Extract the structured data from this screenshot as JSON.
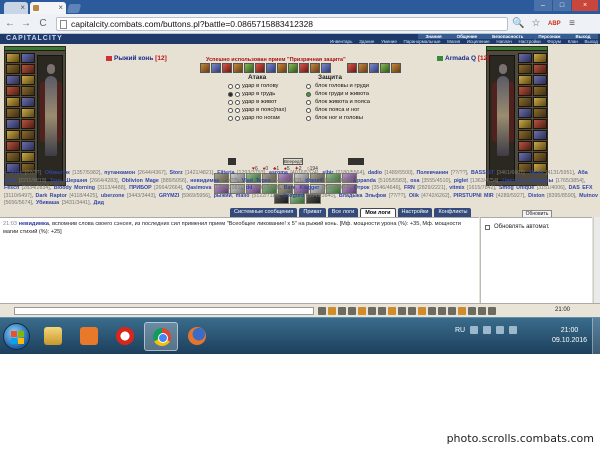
{
  "browser": {
    "tabs": [
      {
        "label": "",
        "close": "×"
      },
      {
        "label": "",
        "close": "×"
      }
    ],
    "window_controls": {
      "minimize": "–",
      "maximize": "□",
      "close": "×"
    },
    "nav": {
      "back": "←",
      "forward": "→",
      "reload": "C"
    },
    "url": "capitalcity.combats.com/buttons.pl?battle=0.0865715883412328",
    "tools": [
      "🔍",
      "☆",
      "ABP",
      "≡"
    ]
  },
  "site": {
    "logo": "CAPITALCITY",
    "top_menu": [
      "Инвентарь",
      "Здание",
      "Умение",
      "Паранормальные",
      "Магия",
      "Исцеление",
      "Наплач",
      "Настройки",
      "Форум",
      "Клан",
      "Выход"
    ],
    "sub_menu": [
      "Знания",
      "Общение",
      "Безопасность",
      "Персонаж",
      "Выход"
    ]
  },
  "battle": {
    "left_name": "Рыжий конь",
    "left_level": "[12]",
    "right_name": "Armada Q",
    "right_level": "[12]",
    "success_msg": "Успешно использован прием \"Призрачная защита\"",
    "attack_title": "Атака",
    "defense_title": "Защита",
    "attack_options": [
      "удар в голову",
      "удар в грудь",
      "удар в живот",
      "удар в пояс(пах)",
      "удар по ногам"
    ],
    "defense_options": [
      "блок головы и груди",
      "блок груди и живота",
      "блок живота и пояса",
      "блок пояса и ног",
      "блок ног и головы"
    ],
    "attack_button": "Вперед!!",
    "stats": [
      "6",
      "0",
      "1",
      "5",
      "2",
      "194"
    ]
  },
  "participants": [
    {
      "name": "s_fenix",
      "hp": "[??/??]"
    },
    {
      "name": "Обмылок",
      "hp": "[1357/5982]"
    },
    {
      "name": "путанкамон",
      "hp": "[2644/4367]"
    },
    {
      "name": "Storz",
      "hp": "[1421/4821]"
    },
    {
      "name": "Filteria",
      "hp": "[1293/3793]"
    },
    {
      "name": "asroma",
      "hp": "[4016/5324]"
    },
    {
      "name": "sibir",
      "hp": "[2180/5564]"
    },
    {
      "name": "dadio",
      "hp": "[1489/5500]"
    },
    {
      "name": "Полевчанин",
      "hp": "[??/??]"
    },
    {
      "name": "BASS-ST",
      "hp": "[3461/6667]"
    },
    {
      "name": "Yazav",
      "hp": "[4131/5951]"
    },
    {
      "name": "Аба хаба",
      "hp": "[2211/3819]"
    },
    {
      "name": "Тень Шершня",
      "hp": "[2664/4283]"
    },
    {
      "name": "Oblivion Mage",
      "hp": "[889/5056]"
    },
    {
      "name": "невидимка",
      "hp": "[??/??]"
    },
    {
      "name": "Vlad_Tepes",
      "hp": "[5618/5822]"
    },
    {
      "name": "titanelf",
      "hp": "[3133/4439]"
    },
    {
      "name": "ppanda",
      "hp": "[5105/5583]"
    },
    {
      "name": "osa",
      "hp": "[3555/4510]"
    },
    {
      "name": "piglet",
      "hp": "[1363/4754]"
    },
    {
      "name": "Цветочек Ланданы",
      "hp": "[1765/3854]"
    },
    {
      "name": "Fesch",
      "hp": "[2834/2834]"
    },
    {
      "name": "Bloody Morning",
      "hp": "[3113/4488]"
    },
    {
      "name": "ПРИБОР",
      "hp": "[2664/2664]"
    },
    {
      "name": "Qasimova",
      "hp": "[1469/3981]"
    },
    {
      "name": "dd",
      "hp": "[989/5473]"
    },
    {
      "name": "Bare",
      "hp": ""
    },
    {
      "name": "Klegger",
      "hp": "[2984/2984]"
    },
    {
      "name": "Отрок",
      "hp": "[3546/4646]"
    },
    {
      "name": "FRN",
      "hp": "[2829/2221]"
    },
    {
      "name": "vitmix",
      "hp": "[1615/7842]"
    },
    {
      "name": "Smog Unique",
      "hp": "[3151/4006]"
    },
    {
      "name": "DAS EFX",
      "hp": "[3110/6497]"
    },
    {
      "name": "Dark Raptor",
      "hp": "[4118/4425]"
    },
    {
      "name": "uberzone",
      "hp": "[3443/3443]"
    },
    {
      "name": "GRYMZI",
      "hp": "[5969/5956]"
    },
    {
      "name": "рыжий",
      "hp": ""
    },
    {
      "name": "malio",
      "hp": "[5122/7118]"
    },
    {
      "name": "bozgurd",
      "hp": "[3649/3840]"
    },
    {
      "name": "Владыка Эльфов",
      "hp": "[??/??]"
    },
    {
      "name": "Olik",
      "hp": "[4742/6262]"
    },
    {
      "name": "PIRSTUPNI MIR",
      "hp": "[4289/5927]"
    },
    {
      "name": "Diston",
      "hp": "[8395/8590]"
    },
    {
      "name": "Mutnov",
      "hp": "[5656/5674]"
    },
    {
      "name": "Убиваша",
      "hp": "[3431/3441]"
    },
    {
      "name": "Дид",
      "hp": ""
    }
  ],
  "log": {
    "tabs": [
      "Системные сообщения",
      "Приват",
      "Все логи",
      "Мои логи",
      "Настройки",
      "Конфликты"
    ],
    "active_tab": "Мои логи",
    "refresh": "Обновить",
    "time": "21:03",
    "who": "невидимка",
    "entry": ", вспомнив слова своего сэнсея, из последних сил применил прием \"Всеобщее ликование! x 5\" на рыжий конь. [Мф. мощности урона (%): +35, Мф. мощности магии стихий (%): +25]",
    "auto_refresh": "Обновлять автомат."
  },
  "chat": {
    "time": "21:00"
  },
  "taskbar": {
    "apps": [
      "folder",
      "media",
      "opera",
      "chrome",
      "firefox"
    ],
    "lang": "RU",
    "clock_time": "21:00",
    "clock_date": "09.10.2016"
  },
  "watermark": "photo.scrolls.combats.com"
}
